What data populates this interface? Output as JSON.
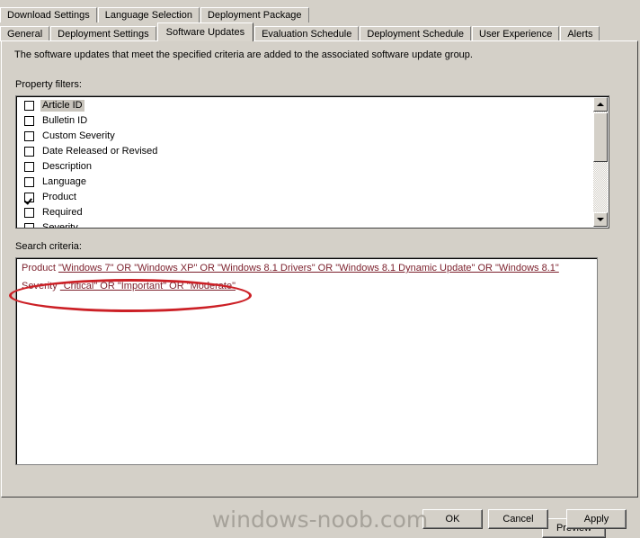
{
  "colors": {
    "dialog_background": "#d4d0c8",
    "field_background": "#ffffff",
    "criteria_text": "#7b1f2b",
    "annotation_red": "#cc2026",
    "watermark_gray": "#a6a29a"
  },
  "tabs": {
    "top_row": [
      {
        "label": "Download Settings",
        "active": false
      },
      {
        "label": "Language Selection",
        "active": false
      },
      {
        "label": "Deployment Package",
        "active": false
      }
    ],
    "bottom_row": [
      {
        "label": "General",
        "active": false
      },
      {
        "label": "Deployment Settings",
        "active": false
      },
      {
        "label": "Software Updates",
        "active": true
      },
      {
        "label": "Evaluation Schedule",
        "active": false
      },
      {
        "label": "Deployment Schedule",
        "active": false
      },
      {
        "label": "User Experience",
        "active": false
      },
      {
        "label": "Alerts",
        "active": false
      }
    ]
  },
  "panel": {
    "description": "The software updates that meet the specified criteria are added to the associated software update group.",
    "property_filters_label": "Property filters:",
    "search_criteria_label": "Search criteria:"
  },
  "property_filters": {
    "items": [
      {
        "label": "Article ID",
        "checked": false,
        "highlighted": true
      },
      {
        "label": "Bulletin ID",
        "checked": false,
        "highlighted": false
      },
      {
        "label": "Custom Severity",
        "checked": false,
        "highlighted": false
      },
      {
        "label": "Date Released or Revised",
        "checked": false,
        "highlighted": false
      },
      {
        "label": "Description",
        "checked": false,
        "highlighted": false
      },
      {
        "label": "Language",
        "checked": false,
        "highlighted": false
      },
      {
        "label": "Product",
        "checked": true,
        "highlighted": false
      },
      {
        "label": "Required",
        "checked": false,
        "highlighted": false
      },
      {
        "label": "Severity",
        "checked": true,
        "highlighted": false
      }
    ]
  },
  "search_criteria": {
    "lines": [
      {
        "property": "Product ",
        "value": "\"Windows 7\" OR \"Windows XP\" OR \"Windows 8.1 Drivers\" OR \"Windows 8.1 Dynamic Update\" OR \"Windows 8.1\""
      },
      {
        "property": "Severity ",
        "value": "\"Critical\" OR \"Important\" OR \"Moderate\""
      }
    ]
  },
  "buttons": {
    "preview": "Preview",
    "ok": "OK",
    "cancel": "Cancel",
    "apply": "Apply"
  },
  "watermark": "windows-noob.com"
}
